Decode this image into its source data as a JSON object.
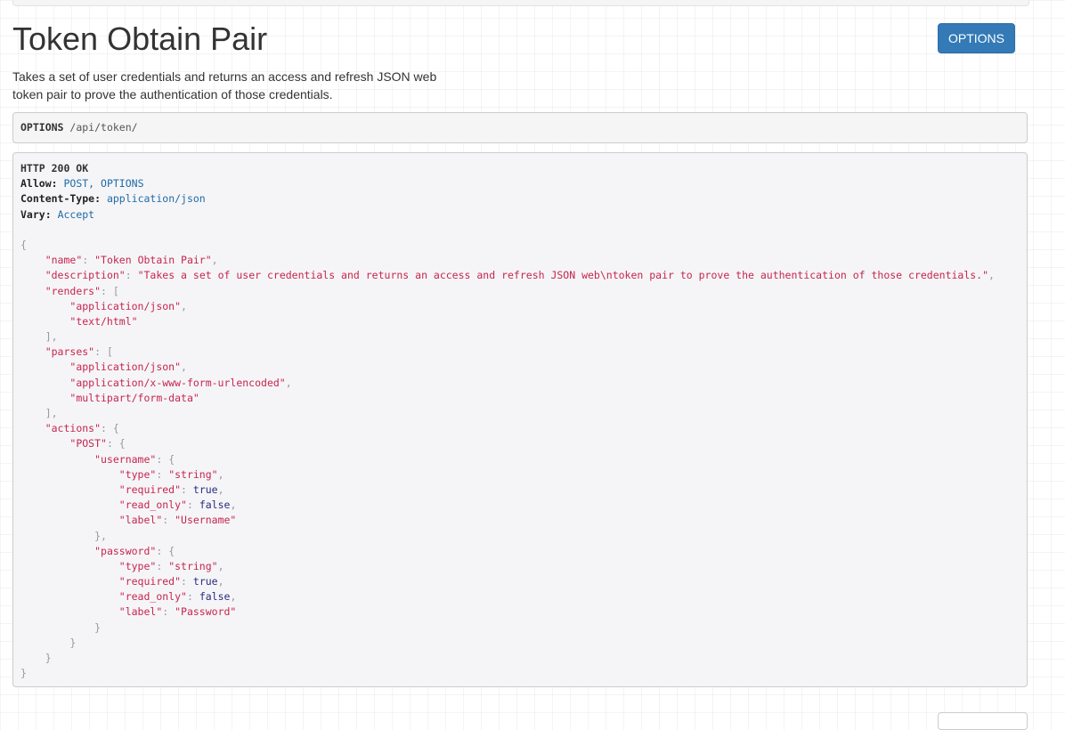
{
  "page": {
    "title": "Token Obtain Pair",
    "description": "Takes a set of user credentials and returns an access and refresh JSON web\ntoken pair to prove the authentication of those credentials.",
    "options_button_label": "OPTIONS"
  },
  "request": {
    "method": "OPTIONS",
    "path": "/api/token/"
  },
  "response": {
    "status_line": "HTTP 200 OK",
    "headers": {
      "allow_key": "Allow:",
      "allow_value": "POST, OPTIONS",
      "content_type_key": "Content-Type:",
      "content_type_value": "application/json",
      "vary_key": "Vary:",
      "vary_value": "Accept"
    },
    "body": {
      "name_key": "\"name\"",
      "name_value": "\"Token Obtain Pair\"",
      "description_key": "\"description\"",
      "description_value": "\"Takes a set of user credentials and returns an access and refresh JSON web\\ntoken pair to prove the authentication of those credentials.\"",
      "renders_key": "\"renders\"",
      "renders": [
        "\"application/json\"",
        "\"text/html\""
      ],
      "parses_key": "\"parses\"",
      "parses": [
        "\"application/json\"",
        "\"application/x-www-form-urlencoded\"",
        "\"multipart/form-data\""
      ],
      "actions_key": "\"actions\"",
      "post_key": "\"POST\"",
      "username": {
        "key": "\"username\"",
        "type_key": "\"type\"",
        "type_value": "\"string\"",
        "required_key": "\"required\"",
        "required_value": "true",
        "read_only_key": "\"read_only\"",
        "read_only_value": "false",
        "label_key": "\"label\"",
        "label_value": "\"Username\""
      },
      "password": {
        "key": "\"password\"",
        "type_key": "\"type\"",
        "type_value": "\"string\"",
        "required_key": "\"required\"",
        "required_value": "true",
        "read_only_key": "\"read_only\"",
        "read_only_value": "false",
        "label_key": "\"label\"",
        "label_value": "\"Password\""
      }
    }
  }
}
